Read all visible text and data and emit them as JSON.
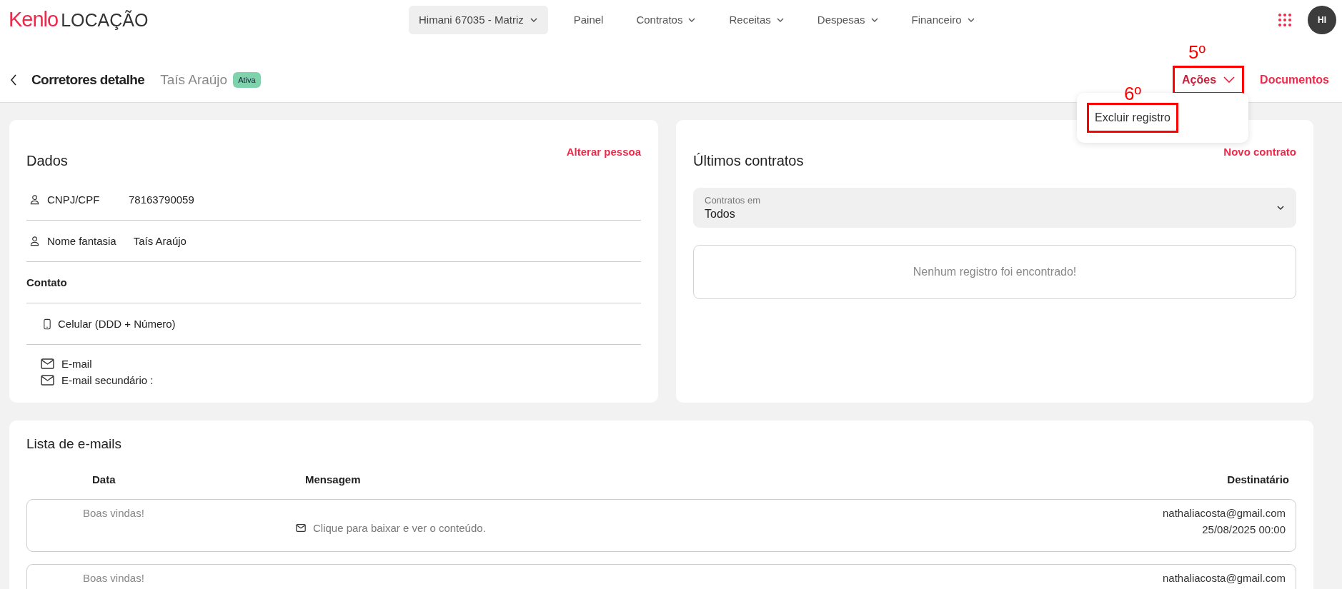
{
  "header": {
    "logo": {
      "brand": "Kenlo",
      "product": "LOCAÇÃO"
    },
    "branch": "Himani 67035 - Matriz",
    "nav": [
      {
        "label": "Painel",
        "has_menu": false
      },
      {
        "label": "Contratos",
        "has_menu": true
      },
      {
        "label": "Receitas",
        "has_menu": true
      },
      {
        "label": "Despesas",
        "has_menu": true
      },
      {
        "label": "Financeiro",
        "has_menu": true
      }
    ],
    "avatar": "HI"
  },
  "page_header": {
    "title": "Corretores detalhe",
    "name": "Taís Araújo",
    "status": "Ativa",
    "actions": {
      "label": "Ações",
      "annotation": "5º",
      "menu": [
        {
          "label": "Excluir registro",
          "annotation": "6º"
        }
      ]
    },
    "documents": "Documentos"
  },
  "dados": {
    "title": "Dados",
    "link": "Alterar pessoa",
    "fields": [
      {
        "kind": "person",
        "label": "CNPJ/CPF",
        "value": "78163790059"
      },
      {
        "kind": "person",
        "label": "Nome fantasia",
        "value": "Taís Araújo"
      }
    ],
    "contact_title": "Contato",
    "phone": "Celular (DDD + Número)",
    "emails": [
      "E-mail",
      "E-mail secundário :"
    ]
  },
  "contratos": {
    "title": "Últimos contratos",
    "link": "Novo contrato",
    "filter": {
      "label": "Contratos em",
      "value": "Todos"
    },
    "empty": "Nenhum registro foi encontrado!"
  },
  "emails": {
    "title": "Lista de e-mails",
    "columns": [
      "Data",
      "Mensagem",
      "Destinatário"
    ],
    "rows": [
      {
        "subject": "Boas vindas!",
        "message": "Clique para baixar e ver o conteúdo.",
        "recipient": "nathaliacosta@gmail.com",
        "date": "25/08/2025 00:00"
      },
      {
        "subject": "Boas vindas!",
        "recipient": "nathaliacosta@gmail.com"
      }
    ]
  }
}
